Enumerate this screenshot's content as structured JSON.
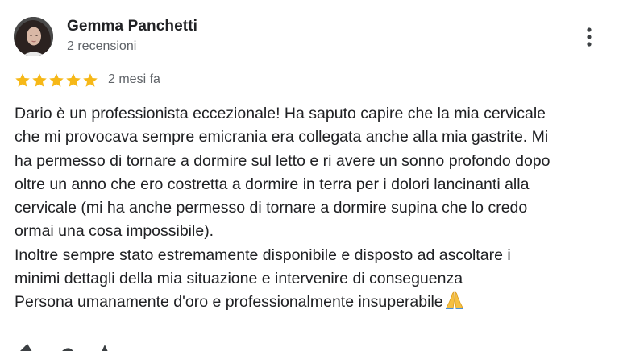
{
  "review": {
    "author_name": "Gemma Panchetti",
    "review_count": "2 recensioni",
    "rating": 5,
    "max_rating": 5,
    "time_ago": "2 mesi fa",
    "lines": [
      "Dario è un professionista eccezionale! Ha saputo capire che la mia cervicale",
      "che mi provocava sempre emicrania era collegata anche alla mia gastrite. Mi",
      "ha permesso di tornare a dormire sul letto e ri avere un sonno profondo dopo",
      "oltre un anno che ero costretta a dormire in terra per i dolori lancinanti alla",
      "cervicale (mi ha anche permesso di tornare a dormire supina che lo credo",
      "ormai una cosa impossibile).",
      "Inoltre sempre stato estremamente disponibile e disposto ad ascoltare i",
      "minimi dettagli della mia situazione e intervenire di conseguenza",
      "Persona umanamente d'oro e professionalmente insuperabile"
    ],
    "emoji_icon": "folded-hands-icon"
  },
  "colors": {
    "star": "#f6b818",
    "secondary_text": "#5f6368",
    "primary_text": "#202124"
  },
  "icons": {
    "more": "more-vertical-icon",
    "star": "star-icon"
  }
}
